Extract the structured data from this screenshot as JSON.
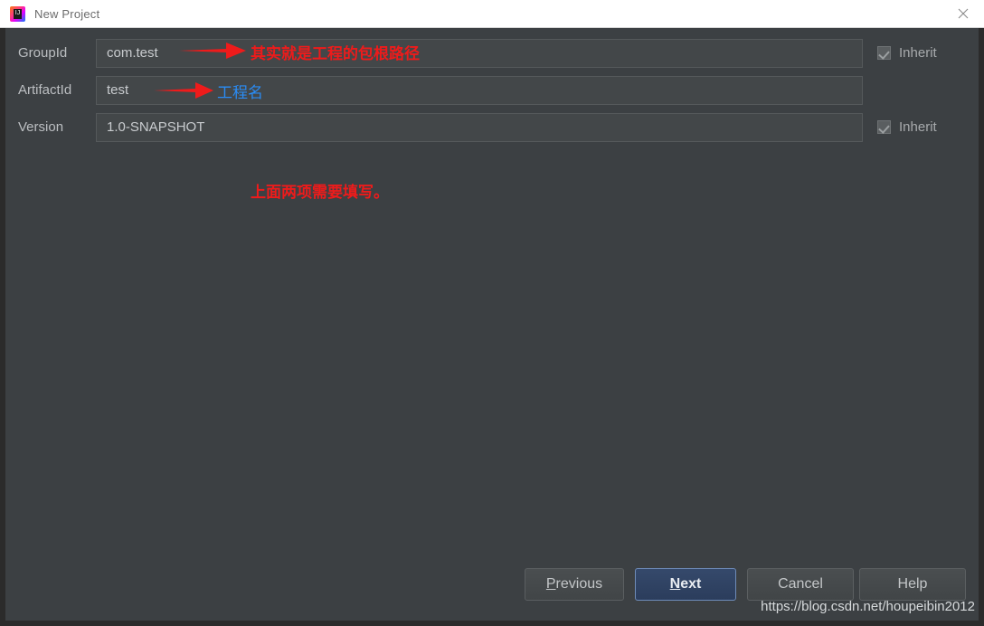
{
  "titlebar": {
    "title": "New Project",
    "app_icon": "intellij-idea-icon",
    "icon_text": "IJ",
    "close_icon": "close-icon"
  },
  "form": {
    "rows": [
      {
        "label": "GroupId",
        "value": "com.test",
        "inherit_label": "Inherit",
        "inherit_checked": true,
        "has_inherit": true
      },
      {
        "label": "ArtifactId",
        "value": "test",
        "inherit_label": "",
        "inherit_checked": false,
        "has_inherit": false
      },
      {
        "label": "Version",
        "value": "1.0-SNAPSHOT",
        "inherit_label": "Inherit",
        "inherit_checked": true,
        "has_inherit": true
      }
    ]
  },
  "annotations": [
    {
      "text": "其实就是工程的包根路径",
      "color": "#ee1b1b",
      "arrow": "red-arrow-right"
    },
    {
      "text": "工程名",
      "color": "#2a8cf5",
      "arrow": "red-arrow-right"
    },
    {
      "text": "上面两项需要填写。",
      "color": "#ee1b1b",
      "arrow": ""
    }
  ],
  "buttons": [
    {
      "label": "Previous",
      "mnemonic": "P",
      "rest": "revious",
      "default": false
    },
    {
      "label": "Next",
      "mnemonic": "N",
      "rest": "ext",
      "default": true
    },
    {
      "label": "Cancel",
      "mnemonic": "",
      "rest": "Cancel",
      "default": false
    },
    {
      "label": "Help",
      "mnemonic": "",
      "rest": "Help",
      "default": false
    }
  ],
  "watermark": {
    "url": "https://blog.csdn.net/houpeibin2012"
  },
  "colors": {
    "panel_bg": "#3c4043",
    "field_bg": "#434749",
    "accent_blue": "#2a8cf5",
    "annotation_red": "#ee1b1b",
    "default_button_bg": "#2b3d5c"
  }
}
